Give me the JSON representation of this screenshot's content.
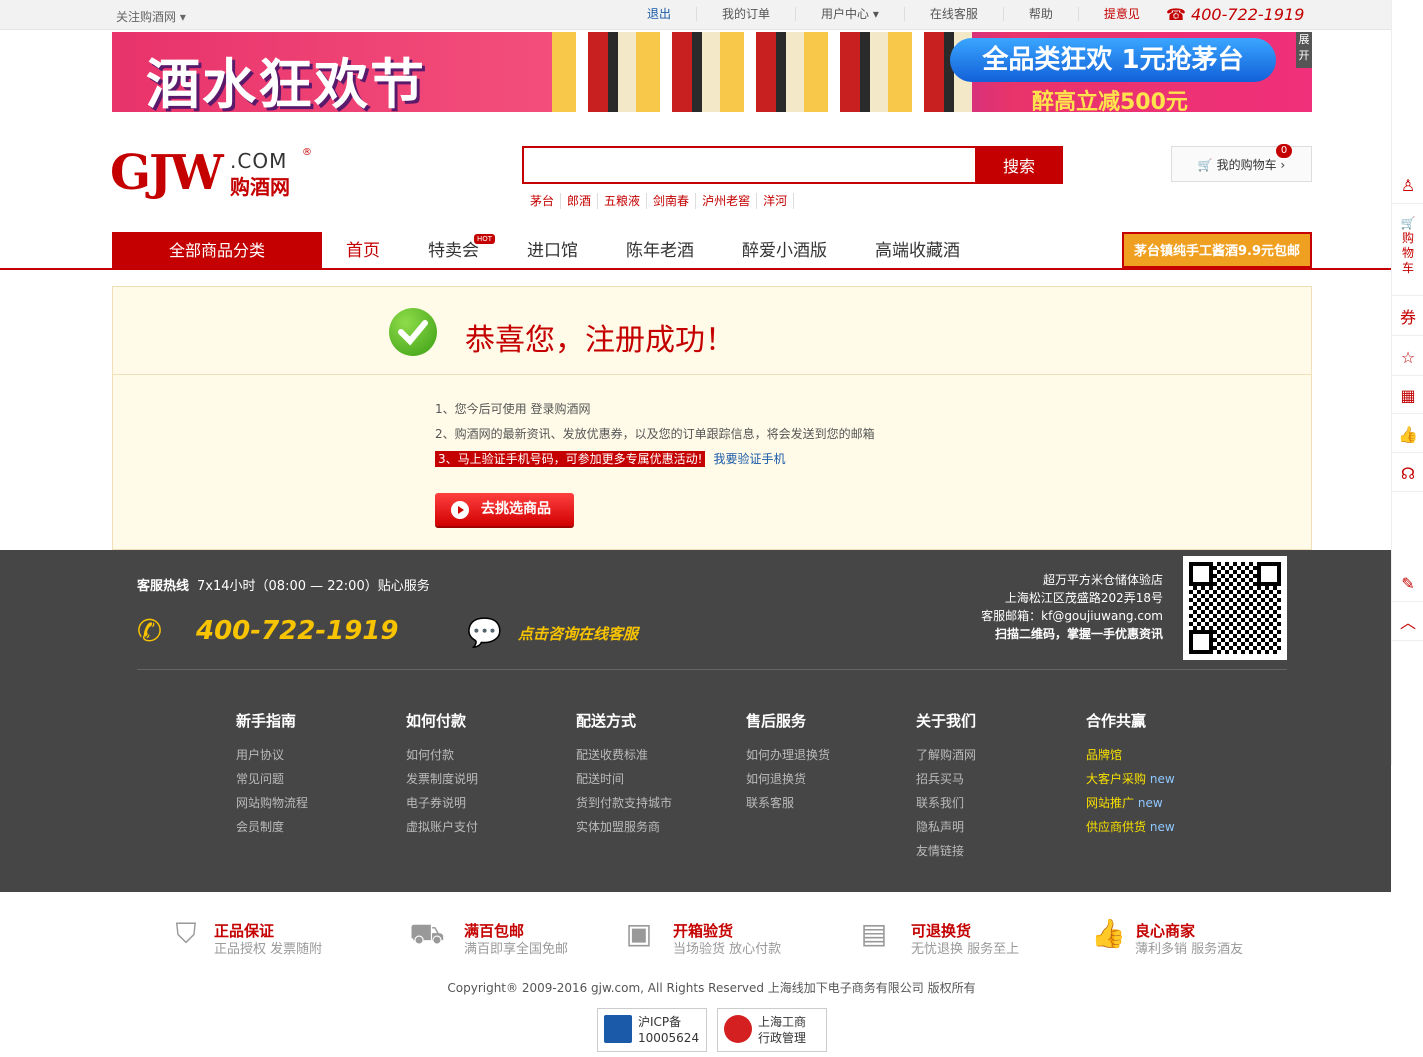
{
  "topbar": {
    "follow": "关注购酒网",
    "links": [
      "退出",
      "我的订单",
      "用户中心",
      "在线客服",
      "帮助",
      "提意见"
    ],
    "phone": "400-722-1919"
  },
  "banner": {
    "headline": "酒水狂欢节",
    "pill": "全品类狂欢 1元抢茅台",
    "sub": "醉高立减500元",
    "expand": "展开"
  },
  "logo": {
    "gjw": "GJW",
    "com": ".COM",
    "cn": "购酒网",
    "reg": "®"
  },
  "search": {
    "button": "搜索",
    "placeholder": "",
    "hotwords": [
      "茅台",
      "郎酒",
      "五粮液",
      "剑南春",
      "泸州老窖",
      "洋河"
    ]
  },
  "cart": {
    "label": "我的购物车",
    "count": "0"
  },
  "nav": {
    "all": "全部商品分类",
    "items": [
      "首页",
      "特卖会",
      "进口馆",
      "陈年老酒",
      "醉爱小酒版",
      "高端收藏酒"
    ],
    "hot": "HOT",
    "promo": "茅台镇纯手工酱酒9.9元包邮"
  },
  "success": {
    "title": "恭喜您，注册成功！",
    "line1": "1、您今后可使用  登录购酒网",
    "line2": "2、购酒网的最新资讯、发放优惠券，以及您的订单跟踪信息，将会发送到您的邮箱",
    "line3": "3、马上验证手机号码，可参加更多专属优惠活动!",
    "verify_link": "我要验证手机",
    "button": "去挑选商品"
  },
  "footer": {
    "hotline_label": "客服热线",
    "hotline_hours": "7x14小时（08:00 — 22:00）贴心服务",
    "phone": "400-722-1919",
    "chat": "点击咨询在线客服",
    "addr1": "超万平方米仓储体验店",
    "addr2": "上海松江区茂盛路202弄18号",
    "addr3": "客服邮箱：kf@goujiuwang.com",
    "addr4": "扫描二维码，掌握一手优惠资讯",
    "cols": [
      {
        "title": "新手指南",
        "items": [
          "用户协议",
          "常见问题",
          "网站购物流程",
          "会员制度"
        ]
      },
      {
        "title": "如何付款",
        "items": [
          "如何付款",
          "发票制度说明",
          "电子券说明",
          "虚拟账户支付"
        ]
      },
      {
        "title": "配送方式",
        "items": [
          "配送收费标准",
          "配送时间",
          "货到付款支持城市",
          "实体加盟服务商"
        ]
      },
      {
        "title": "售后服务",
        "items": [
          "如何办理退换货",
          "如何退换货",
          "联系客服"
        ]
      },
      {
        "title": "关于我们",
        "items": [
          "了解购酒网",
          "招兵买马",
          "联系我们",
          "隐私声明",
          "友情链接"
        ]
      },
      {
        "title": "合作共赢",
        "items": [
          "品牌馆",
          "大客户采购",
          "网站推广",
          "供应商供货"
        ],
        "new": "new"
      }
    ]
  },
  "guarantees": [
    {
      "title": "正品保证",
      "sub": "正品授权 发票随附",
      "icon": "shield-icon"
    },
    {
      "title": "满百包邮",
      "sub": "满百即享全国免邮",
      "icon": "truck-icon"
    },
    {
      "title": "开箱验货",
      "sub": "当场验货 放心付款",
      "icon": "box-icon"
    },
    {
      "title": "可退换货",
      "sub": "无忧退换 服务至上",
      "icon": "card-icon"
    },
    {
      "title": "良心商家",
      "sub": "薄利多销 服务酒友",
      "icon": "thumb-icon"
    }
  ],
  "copyright": "Copyright® 2009-2016 gjw.com, All Rights Reserved 上海线加下电子商务有限公司 版权所有",
  "badges": [
    {
      "line1": "沪ICP备",
      "line2": "10005624"
    },
    {
      "line1": "上海工商",
      "line2": "行政管理"
    }
  ],
  "sidebar": {
    "cart": "购物车",
    "coupon": "券"
  },
  "colors": {
    "brand": "#c40000",
    "footer_bg": "#464646",
    "success_bg": "#fffbe8",
    "accent_yellow": "#f8c300"
  }
}
